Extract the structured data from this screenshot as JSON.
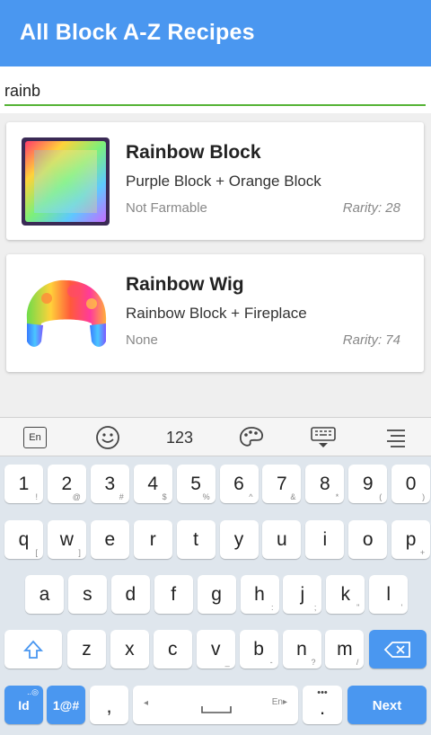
{
  "app": {
    "title": "All Block A-Z Recipes"
  },
  "search": {
    "value": "rainb"
  },
  "results": [
    {
      "name": "Rainbow Block",
      "recipe": "Purple Block + Orange Block",
      "farm": "Not Farmable",
      "rarity": "Rarity: 28"
    },
    {
      "name": "Rainbow Wig",
      "recipe": "Rainbow Block + Fireplace",
      "farm": "None",
      "rarity": "Rarity: 74"
    }
  ],
  "keyboard": {
    "toolbar": {
      "lang": "En",
      "numbers": "123"
    },
    "row1": [
      {
        "m": "1",
        "s": "!"
      },
      {
        "m": "2",
        "s": "@"
      },
      {
        "m": "3",
        "s": "#"
      },
      {
        "m": "4",
        "s": "$"
      },
      {
        "m": "5",
        "s": "%"
      },
      {
        "m": "6",
        "s": "^"
      },
      {
        "m": "7",
        "s": "&"
      },
      {
        "m": "8",
        "s": "*"
      },
      {
        "m": "9",
        "s": "("
      },
      {
        "m": "0",
        "s": ")"
      }
    ],
    "row2": [
      {
        "m": "q",
        "s": "["
      },
      {
        "m": "w",
        "s": "]"
      },
      {
        "m": "e",
        "s": ""
      },
      {
        "m": "r",
        "s": ""
      },
      {
        "m": "t",
        "s": ""
      },
      {
        "m": "y",
        "s": ""
      },
      {
        "m": "u",
        "s": ""
      },
      {
        "m": "i",
        "s": ""
      },
      {
        "m": "o",
        "s": ""
      },
      {
        "m": "p",
        "s": "+"
      }
    ],
    "row3": [
      {
        "m": "a",
        "s": ""
      },
      {
        "m": "s",
        "s": ""
      },
      {
        "m": "d",
        "s": ""
      },
      {
        "m": "f",
        "s": ""
      },
      {
        "m": "g",
        "s": ""
      },
      {
        "m": "h",
        "s": ":"
      },
      {
        "m": "j",
        "s": ";"
      },
      {
        "m": "k",
        "s": "\""
      },
      {
        "m": "l",
        "s": "'"
      }
    ],
    "row4": [
      {
        "m": "z",
        "s": ""
      },
      {
        "m": "x",
        "s": ""
      },
      {
        "m": "c",
        "s": ""
      },
      {
        "m": "v",
        "s": "_"
      },
      {
        "m": "b",
        "s": "-"
      },
      {
        "m": "n",
        "s": "?"
      },
      {
        "m": "m",
        "s": "/"
      }
    ],
    "lang_key": "Id",
    "sym_key": "1@#",
    "comma": ",",
    "space_lang": "En",
    "period": ".",
    "next": "Next"
  }
}
